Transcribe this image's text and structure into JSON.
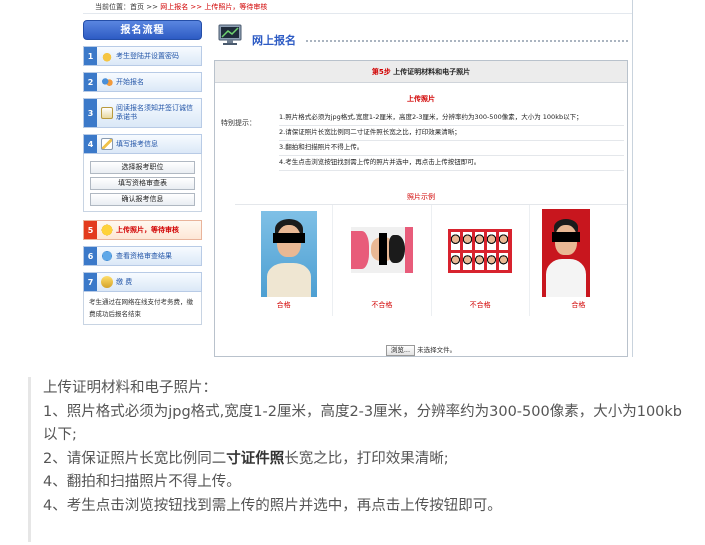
{
  "breadcrumb": {
    "prefix": "当前位置：首页 >>",
    "current": "网上报名 >> 上传照片，等待审核"
  },
  "sidebar": {
    "header": "报名流程",
    "steps": [
      {
        "num": "1",
        "label": "考生登陆并设置密码"
      },
      {
        "num": "2",
        "label": "开始报名"
      },
      {
        "num": "3",
        "label": "阅读报名须知并签订诚信承诺书"
      },
      {
        "num": "4",
        "label": "填写报考信息"
      },
      {
        "num": "5",
        "label": "上传照片，等待审核"
      },
      {
        "num": "6",
        "label": "查看资格审查结果"
      },
      {
        "num": "7",
        "label": "缴 费"
      }
    ],
    "sub_buttons": [
      "选择报考职位",
      "填写资格审查表",
      "确认报考信息"
    ],
    "note": "考生通过在网络在线支付考务费，缴费成功后报名结束"
  },
  "main": {
    "title": "网上报名",
    "step_prefix": "第5步",
    "step_title": "上传证明材料和电子照片",
    "section_title": "上传照片",
    "tips_label": "特别提示：",
    "tips": [
      "1.照片格式必须为jpg格式,宽度1-2厘米，高度2-3厘米，分辨率约为300-500像素，大小为 100kb以下；",
      "2.请保证照片长宽比例同二寸证件照长宽之比，打印效果清晰；",
      "3.翻拍和扫描照片不得上传。",
      "4.考生点击浏览按钮找到需上传的照片并选中，再点击上传按钮即可。"
    ],
    "samples_title": "照片示例",
    "samples": [
      {
        "verdict": "合格"
      },
      {
        "verdict": "不合格"
      },
      {
        "verdict": "不合格"
      },
      {
        "verdict": "合格"
      }
    ],
    "browse_label": "浏览...",
    "no_file_label": "未选择文件。"
  },
  "quote": {
    "heading": "上传证明材料和电子照片：",
    "line1": "1、照片格式必须为jpg格式,宽度1-2厘米，高度2-3厘米，分辨率约为300-500像素，大小为100kb以下;",
    "line2_before": "2、请保证照片长宽比例同二",
    "line2_bold": "寸证件照",
    "line2_after": "长宽之比，打印效果清晰;",
    "line3": "4、翻拍和扫描照片不得上传。",
    "line4": "4、考生点击浏览按钮找到需上传的照片并选中，再点击上传按钮即可。"
  },
  "colors": {
    "accent_blue": "#2d5bc4",
    "alert_red": "#d10000",
    "step_num_blue": "#3b79c9",
    "step_num_active": "#e33b1c"
  }
}
